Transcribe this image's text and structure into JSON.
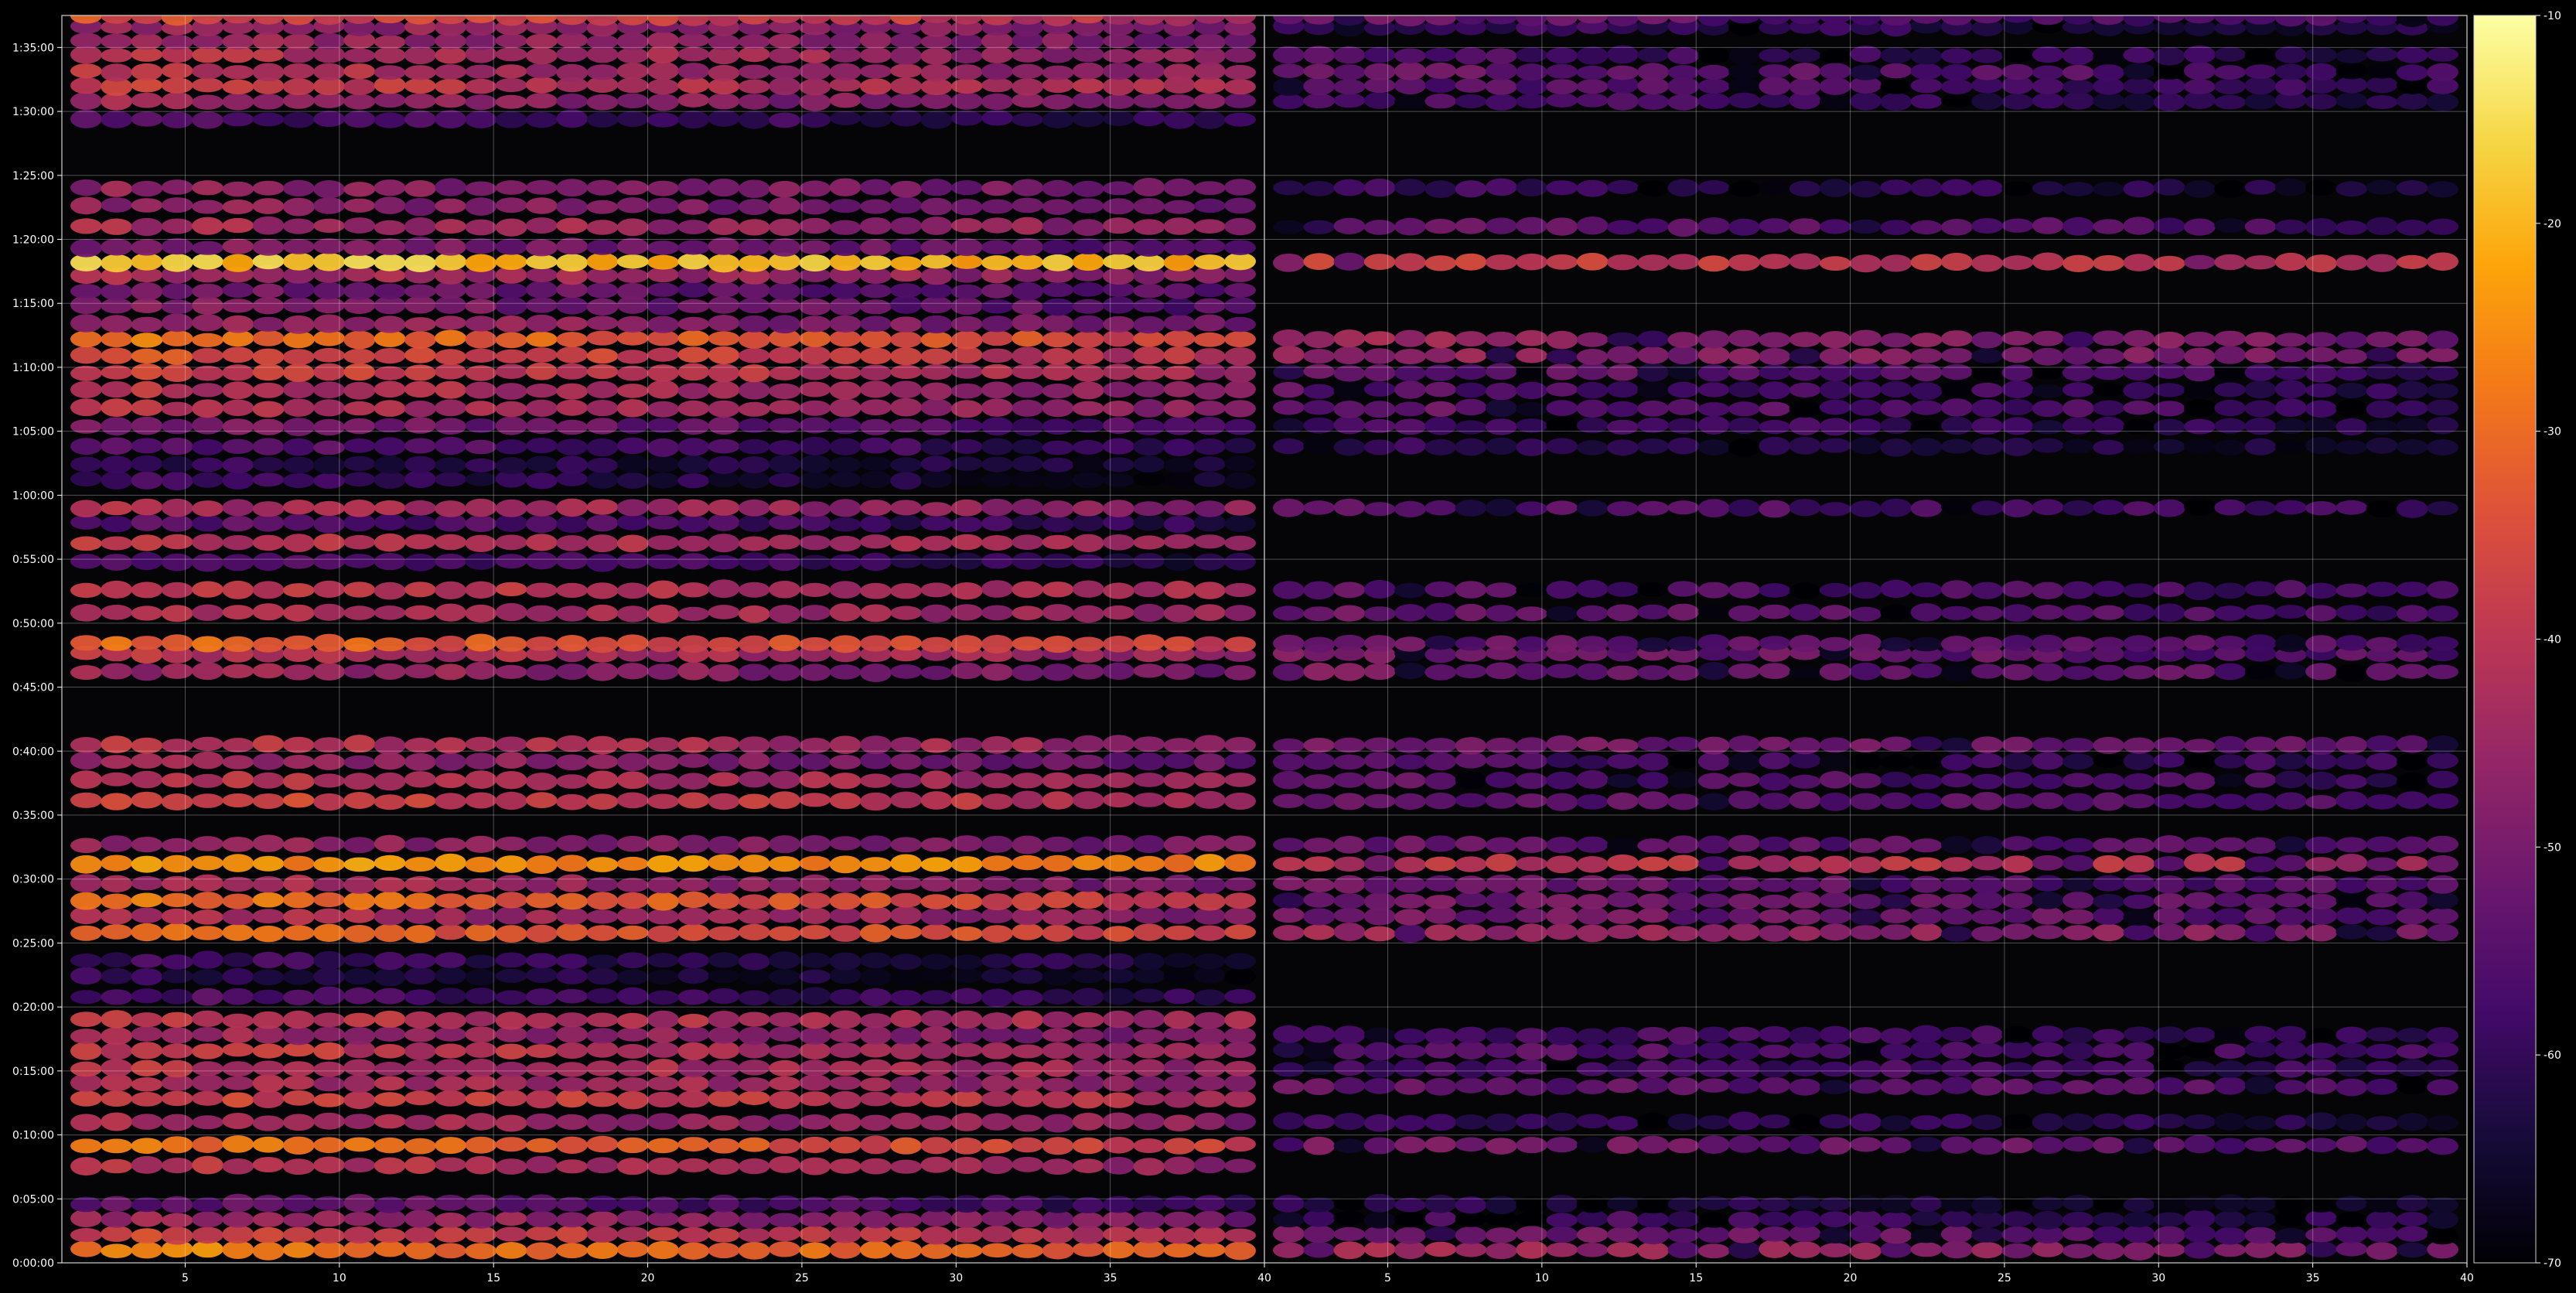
{
  "chart_data": {
    "type": "heatmap",
    "title": "",
    "xlabel": "",
    "ylabel": "",
    "grid": true,
    "panels": [
      {
        "name": "",
        "x_tick_labels": [
          "5",
          "10",
          "15",
          "20",
          "25",
          "30",
          "35",
          "40"
        ],
        "xlim": [
          1,
          40
        ]
      },
      {
        "name": "",
        "x_tick_labels": [
          "5",
          "10",
          "15",
          "20",
          "25",
          "30",
          "35",
          "40"
        ],
        "xlim": [
          1,
          40
        ]
      }
    ],
    "x_positions": 39,
    "y_tick_labels": [
      "0:00:00",
      "0:05:00",
      "0:10:00",
      "0:15:00",
      "0:20:00",
      "0:25:00",
      "0:30:00",
      "0:35:00",
      "0:40:00",
      "0:45:00",
      "0:50:00",
      "0:55:00",
      "1:00:00",
      "1:05:00",
      "1:10:00",
      "1:15:00",
      "1:20:00",
      "1:25:00",
      "1:30:00",
      "1:35:00"
    ],
    "ylim_minutes": [
      0,
      97.5
    ],
    "colorbar": {
      "colormap": "inferno",
      "range": [
        -70,
        -10
      ],
      "tick_labels": [
        "-70",
        "-60",
        "-50",
        "-40",
        "-30",
        "-20",
        "-10"
      ]
    },
    "band_units": "minutes; intensity in colorbar units",
    "bands_left": [
      [
        1.0,
        -26,
        0.5
      ],
      [
        2.2,
        -36,
        0.4
      ],
      [
        3.4,
        -44,
        0.4
      ],
      [
        4.6,
        -52,
        0.6
      ],
      [
        7.6,
        -40,
        0.5
      ],
      [
        9.2,
        -28,
        0.7
      ],
      [
        11.0,
        -42,
        0.4
      ],
      [
        12.8,
        -36,
        0.4
      ],
      [
        14.0,
        -42,
        0.3
      ],
      [
        15.2,
        -40,
        0.4
      ],
      [
        16.6,
        -38,
        0.5
      ],
      [
        17.8,
        -44,
        0.4
      ],
      [
        19.0,
        -40,
        0.3
      ],
      [
        20.8,
        -56,
        0.4
      ],
      [
        22.4,
        -60,
        0.5
      ],
      [
        23.6,
        -58,
        0.4
      ],
      [
        25.8,
        -30,
        0.5
      ],
      [
        27.1,
        -42,
        0.4
      ],
      [
        28.3,
        -28,
        0.7
      ],
      [
        29.6,
        -42,
        0.6
      ],
      [
        31.2,
        -24,
        0.2
      ],
      [
        32.7,
        -46,
        0.3
      ],
      [
        36.1,
        -36,
        0.4
      ],
      [
        37.7,
        -40,
        0.4
      ],
      [
        39.2,
        -44,
        0.6
      ],
      [
        40.5,
        -40,
        0.4
      ],
      [
        46.2,
        -44,
        0.5
      ],
      [
        47.6,
        -40,
        0.4
      ],
      [
        48.4,
        -30,
        0.6
      ],
      [
        50.8,
        -40,
        0.4
      ],
      [
        52.6,
        -38,
        0.4
      ],
      [
        54.8,
        -54,
        0.6
      ],
      [
        56.3,
        -40,
        0.4
      ],
      [
        57.8,
        -54,
        0.5
      ],
      [
        59.0,
        -42,
        0.4
      ],
      [
        61.2,
        -58,
        0.6
      ],
      [
        62.4,
        -60,
        0.4
      ],
      [
        63.8,
        -54,
        0.5
      ],
      [
        65.4,
        -48,
        0.7
      ],
      [
        66.8,
        -40,
        0.5
      ],
      [
        68.2,
        -40,
        0.5
      ],
      [
        69.6,
        -36,
        0.6
      ],
      [
        70.9,
        -34,
        0.5
      ],
      [
        72.2,
        -28,
        0.6
      ],
      [
        73.4,
        -44,
        0.5
      ],
      [
        74.8,
        -48,
        0.5
      ],
      [
        76.0,
        -50,
        0.4
      ],
      [
        77.2,
        -42,
        0.4
      ],
      [
        78.2,
        -18,
        0.2
      ],
      [
        79.4,
        -48,
        0.5
      ],
      [
        81.0,
        -42,
        0.4
      ],
      [
        82.6,
        -46,
        0.4
      ],
      [
        84.0,
        -46,
        0.4
      ],
      [
        89.4,
        -56,
        0.4
      ],
      [
        90.8,
        -44,
        0.5
      ],
      [
        92.0,
        -38,
        0.4
      ],
      [
        93.1,
        -40,
        0.5
      ],
      [
        94.4,
        -40,
        0.5
      ],
      [
        95.5,
        -44,
        0.4
      ],
      [
        96.6,
        -44,
        0.4
      ],
      [
        97.4,
        -34,
        0.5
      ]
    ],
    "bands_right": [
      [
        1.0,
        -44,
        0.4
      ],
      [
        2.2,
        -50,
        0.4
      ],
      [
        3.4,
        -56,
        0.4
      ],
      [
        4.6,
        -60,
        0.4
      ],
      [
        9.2,
        -50,
        0.4
      ],
      [
        11.0,
        -58,
        0.4
      ],
      [
        13.8,
        -52,
        0.3
      ],
      [
        15.2,
        -56,
        0.3
      ],
      [
        16.6,
        -54,
        0.3
      ],
      [
        17.8,
        -56,
        0.3
      ],
      [
        25.8,
        -44,
        0.4
      ],
      [
        27.1,
        -50,
        0.4
      ],
      [
        28.3,
        -50,
        0.4
      ],
      [
        29.6,
        -52,
        0.3
      ],
      [
        31.2,
        -40,
        0.15
      ],
      [
        32.7,
        -52,
        0.3
      ],
      [
        36.1,
        -52,
        0.4
      ],
      [
        37.7,
        -54,
        0.3
      ],
      [
        39.2,
        -56,
        0.3
      ],
      [
        40.5,
        -50,
        0.3
      ],
      [
        46.2,
        -50,
        0.4
      ],
      [
        47.6,
        -50,
        0.4
      ],
      [
        48.4,
        -52,
        0.3
      ],
      [
        50.8,
        -52,
        0.4
      ],
      [
        52.6,
        -54,
        0.3
      ],
      [
        59.0,
        -54,
        0.4
      ],
      [
        63.8,
        -60,
        0.4
      ],
      [
        65.4,
        -56,
        0.5
      ],
      [
        66.8,
        -52,
        0.5
      ],
      [
        68.2,
        -54,
        0.5
      ],
      [
        69.6,
        -52,
        0.5
      ],
      [
        70.9,
        -46,
        0.4
      ],
      [
        72.2,
        -44,
        0.5
      ],
      [
        78.2,
        -38,
        0.25
      ],
      [
        81.0,
        -52,
        0.4
      ],
      [
        84.0,
        -58,
        0.4
      ],
      [
        90.8,
        -56,
        0.5
      ],
      [
        92.0,
        -54,
        0.4
      ],
      [
        93.1,
        -52,
        0.4
      ],
      [
        94.4,
        -56,
        0.4
      ],
      [
        96.6,
        -58,
        0.4
      ],
      [
        97.4,
        -52,
        0.4
      ]
    ]
  }
}
